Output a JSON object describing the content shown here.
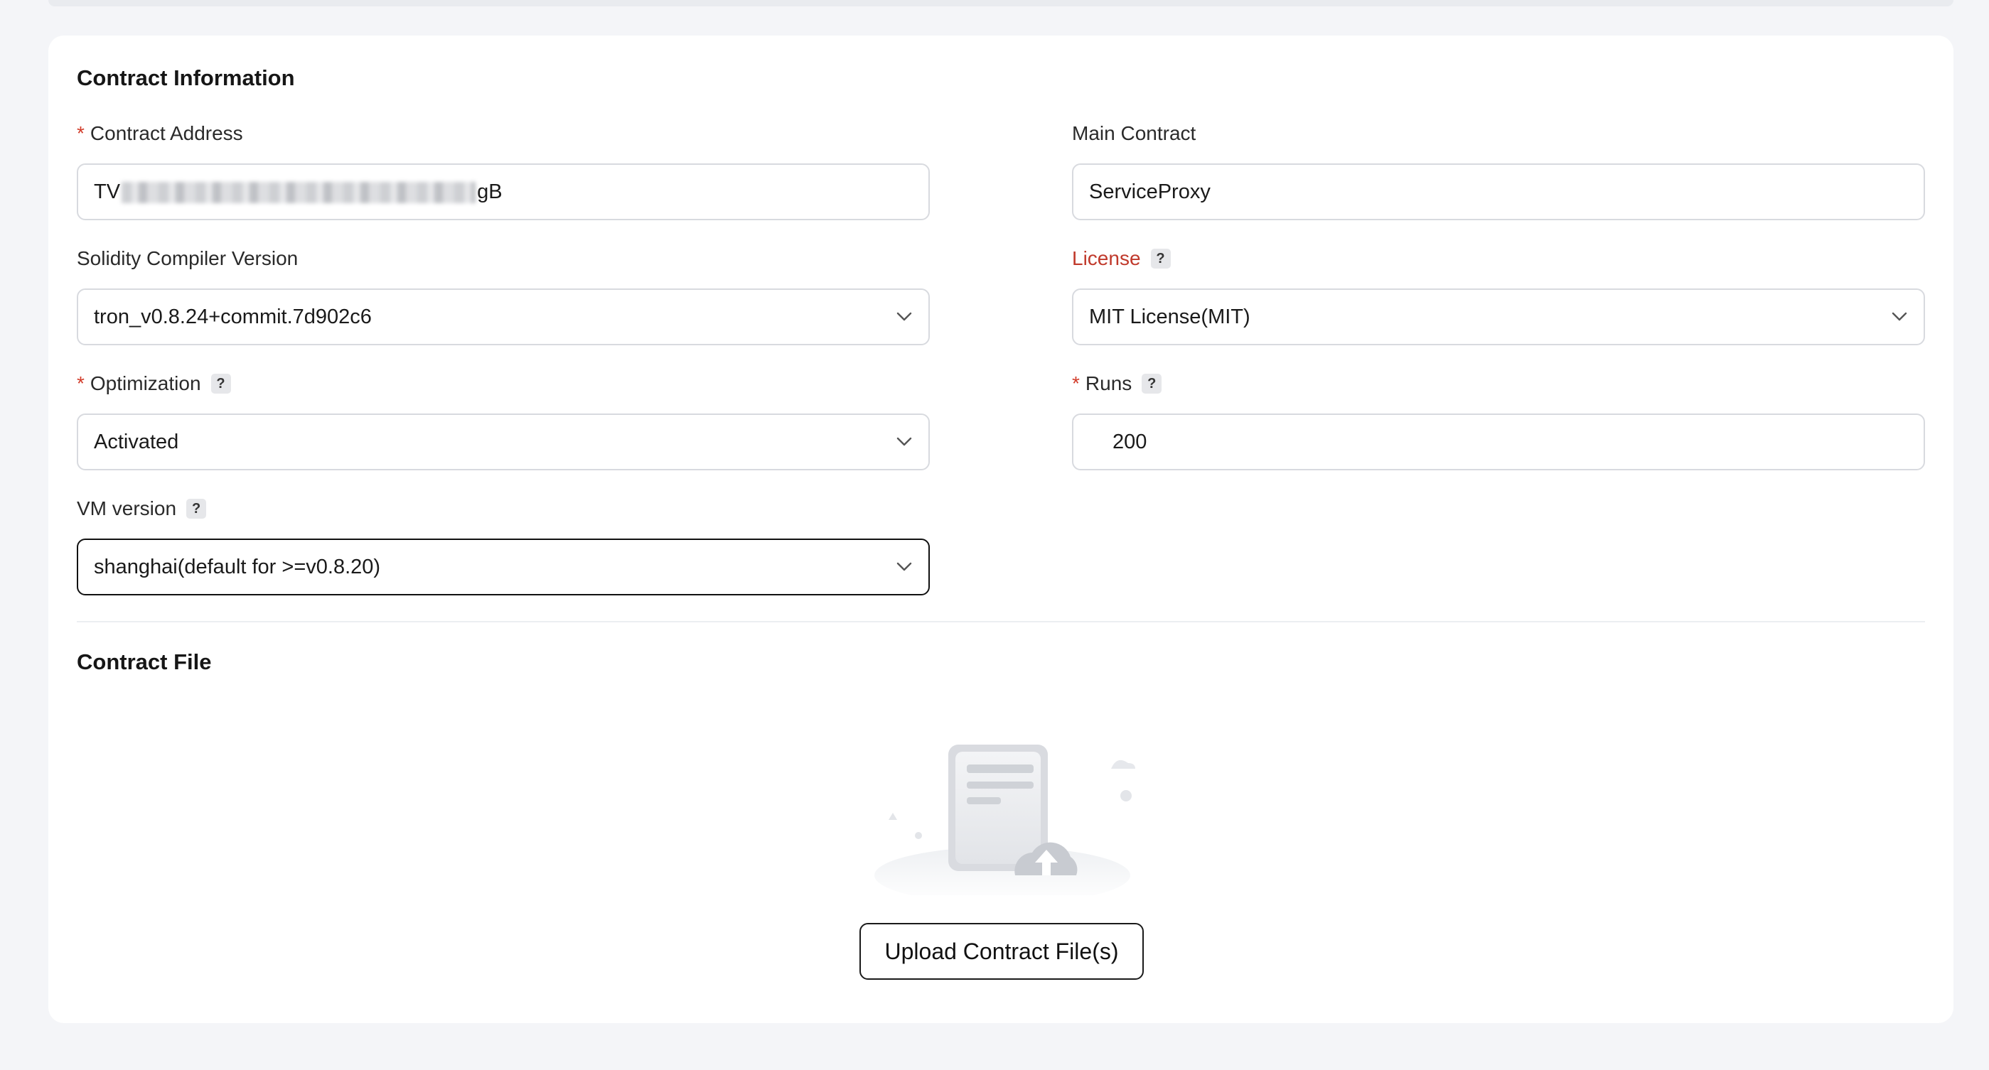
{
  "contract_information": {
    "title": "Contract Information",
    "contract_address": {
      "label": "Contract Address",
      "required": "*",
      "value_prefix": "TV",
      "value_suffix": "gB"
    },
    "main_contract": {
      "label": "Main Contract",
      "value": "ServiceProxy"
    },
    "compiler_version": {
      "label": "Solidity Compiler Version",
      "value": "tron_v0.8.24+commit.7d902c6"
    },
    "license": {
      "label": "License",
      "help": "?",
      "value": "MIT License(MIT)",
      "label_color": "#c0392b"
    },
    "optimization": {
      "label": "Optimization",
      "required": "*",
      "help": "?",
      "value": "Activated"
    },
    "runs": {
      "label": "Runs",
      "required": "*",
      "help": "?",
      "value": "200"
    },
    "vm_version": {
      "label": "VM version",
      "help": "?",
      "value": "shanghai(default for >=v0.8.20)"
    }
  },
  "contract_file": {
    "title": "Contract File",
    "upload_label": "Upload Contract File(s)"
  },
  "colors": {
    "page_background": "#f4f5f8",
    "card_background": "#ffffff",
    "required_mark": "#d23c2a",
    "input_border": "#d8dadf",
    "focused_border": "#111111"
  },
  "icons": {
    "select_arrow": "chevron-down-icon",
    "upload_illustration": "document-upload-icon",
    "help": "question-mark-icon"
  }
}
